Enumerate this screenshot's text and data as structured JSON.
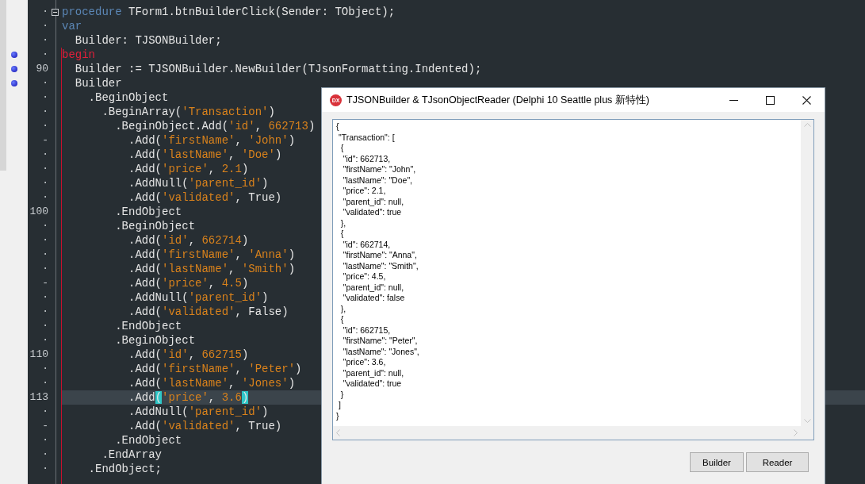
{
  "editor": {
    "lines": [
      {
        "gutter": "·",
        "breakpoint": false,
        "current": false,
        "foldable": true,
        "tokens": [
          {
            "kind": "keyword",
            "text": "procedure"
          },
          {
            "kind": "plain",
            "text": " TForm1.btnBuilderClick(Sender: TObject);"
          }
        ]
      },
      {
        "gutter": "·",
        "breakpoint": false,
        "current": false,
        "foldable": false,
        "tokens": [
          {
            "kind": "keyword",
            "text": "var"
          }
        ]
      },
      {
        "gutter": "·",
        "breakpoint": false,
        "current": false,
        "foldable": false,
        "tokens": [
          {
            "kind": "plain",
            "text": "  Builder: TJSONBuilder;"
          }
        ]
      },
      {
        "gutter": "·",
        "breakpoint": true,
        "current": false,
        "foldable": false,
        "tokens": [
          {
            "kind": "begin",
            "text": "begin"
          }
        ]
      },
      {
        "gutter": "90",
        "breakpoint": true,
        "current": false,
        "foldable": false,
        "tokens": [
          {
            "kind": "plain",
            "text": "  Builder := TJSONBuilder.NewBuilder(TJsonFormatting.Indented);"
          }
        ]
      },
      {
        "gutter": "·",
        "breakpoint": true,
        "current": false,
        "foldable": false,
        "tokens": [
          {
            "kind": "plain",
            "text": "  Builder"
          }
        ]
      },
      {
        "gutter": "·",
        "breakpoint": false,
        "current": false,
        "foldable": false,
        "tokens": [
          {
            "kind": "plain",
            "text": "    .BeginObject"
          }
        ]
      },
      {
        "gutter": "·",
        "breakpoint": false,
        "current": false,
        "foldable": false,
        "tokens": [
          {
            "kind": "plain",
            "text": "      .BeginArray("
          },
          {
            "kind": "string",
            "text": "'Transaction'"
          },
          {
            "kind": "plain",
            "text": ")"
          }
        ]
      },
      {
        "gutter": "·",
        "breakpoint": false,
        "current": false,
        "foldable": false,
        "tokens": [
          {
            "kind": "plain",
            "text": "        .BeginObject.Add("
          },
          {
            "kind": "string",
            "text": "'id'"
          },
          {
            "kind": "plain",
            "text": ", "
          },
          {
            "kind": "number",
            "text": "662713"
          },
          {
            "kind": "plain",
            "text": ")"
          }
        ]
      },
      {
        "gutter": "-",
        "breakpoint": false,
        "current": false,
        "foldable": false,
        "tokens": [
          {
            "kind": "plain",
            "text": "          .Add("
          },
          {
            "kind": "string",
            "text": "'firstName'"
          },
          {
            "kind": "plain",
            "text": ", "
          },
          {
            "kind": "string",
            "text": "'John'"
          },
          {
            "kind": "plain",
            "text": ")"
          }
        ]
      },
      {
        "gutter": "·",
        "breakpoint": false,
        "current": false,
        "foldable": false,
        "tokens": [
          {
            "kind": "plain",
            "text": "          .Add("
          },
          {
            "kind": "string",
            "text": "'lastName'"
          },
          {
            "kind": "plain",
            "text": ", "
          },
          {
            "kind": "string",
            "text": "'Doe'"
          },
          {
            "kind": "plain",
            "text": ")"
          }
        ]
      },
      {
        "gutter": "·",
        "breakpoint": false,
        "current": false,
        "foldable": false,
        "tokens": [
          {
            "kind": "plain",
            "text": "          .Add("
          },
          {
            "kind": "string",
            "text": "'price'"
          },
          {
            "kind": "plain",
            "text": ", "
          },
          {
            "kind": "number",
            "text": "2.1"
          },
          {
            "kind": "plain",
            "text": ")"
          }
        ]
      },
      {
        "gutter": "·",
        "breakpoint": false,
        "current": false,
        "foldable": false,
        "tokens": [
          {
            "kind": "plain",
            "text": "          .AddNull("
          },
          {
            "kind": "string",
            "text": "'parent_id'"
          },
          {
            "kind": "plain",
            "text": ")"
          }
        ]
      },
      {
        "gutter": "·",
        "breakpoint": false,
        "current": false,
        "foldable": false,
        "tokens": [
          {
            "kind": "plain",
            "text": "          .Add("
          },
          {
            "kind": "string",
            "text": "'validated'"
          },
          {
            "kind": "plain",
            "text": ", True)"
          }
        ]
      },
      {
        "gutter": "100",
        "breakpoint": false,
        "current": false,
        "foldable": false,
        "tokens": [
          {
            "kind": "plain",
            "text": "        .EndObject"
          }
        ]
      },
      {
        "gutter": "·",
        "breakpoint": false,
        "current": false,
        "foldable": false,
        "tokens": [
          {
            "kind": "plain",
            "text": "        .BeginObject"
          }
        ]
      },
      {
        "gutter": "·",
        "breakpoint": false,
        "current": false,
        "foldable": false,
        "tokens": [
          {
            "kind": "plain",
            "text": "          .Add("
          },
          {
            "kind": "string",
            "text": "'id'"
          },
          {
            "kind": "plain",
            "text": ", "
          },
          {
            "kind": "number",
            "text": "662714"
          },
          {
            "kind": "plain",
            "text": ")"
          }
        ]
      },
      {
        "gutter": "·",
        "breakpoint": false,
        "current": false,
        "foldable": false,
        "tokens": [
          {
            "kind": "plain",
            "text": "          .Add("
          },
          {
            "kind": "string",
            "text": "'firstName'"
          },
          {
            "kind": "plain",
            "text": ", "
          },
          {
            "kind": "string",
            "text": "'Anna'"
          },
          {
            "kind": "plain",
            "text": ")"
          }
        ]
      },
      {
        "gutter": "·",
        "breakpoint": false,
        "current": false,
        "foldable": false,
        "tokens": [
          {
            "kind": "plain",
            "text": "          .Add("
          },
          {
            "kind": "string",
            "text": "'lastName'"
          },
          {
            "kind": "plain",
            "text": ", "
          },
          {
            "kind": "string",
            "text": "'Smith'"
          },
          {
            "kind": "plain",
            "text": ")"
          }
        ]
      },
      {
        "gutter": "-",
        "breakpoint": false,
        "current": false,
        "foldable": false,
        "tokens": [
          {
            "kind": "plain",
            "text": "          .Add("
          },
          {
            "kind": "string",
            "text": "'price'"
          },
          {
            "kind": "plain",
            "text": ", "
          },
          {
            "kind": "number",
            "text": "4.5"
          },
          {
            "kind": "plain",
            "text": ")"
          }
        ]
      },
      {
        "gutter": "·",
        "breakpoint": false,
        "current": false,
        "foldable": false,
        "tokens": [
          {
            "kind": "plain",
            "text": "          .AddNull("
          },
          {
            "kind": "string",
            "text": "'parent_id'"
          },
          {
            "kind": "plain",
            "text": ")"
          }
        ]
      },
      {
        "gutter": "·",
        "breakpoint": false,
        "current": false,
        "foldable": false,
        "tokens": [
          {
            "kind": "plain",
            "text": "          .Add("
          },
          {
            "kind": "string",
            "text": "'validated'"
          },
          {
            "kind": "plain",
            "text": ", False)"
          }
        ]
      },
      {
        "gutter": "·",
        "breakpoint": false,
        "current": false,
        "foldable": false,
        "tokens": [
          {
            "kind": "plain",
            "text": "        .EndObject"
          }
        ]
      },
      {
        "gutter": "·",
        "breakpoint": false,
        "current": false,
        "foldable": false,
        "tokens": [
          {
            "kind": "plain",
            "text": "        .BeginObject"
          }
        ]
      },
      {
        "gutter": "110",
        "breakpoint": false,
        "current": false,
        "foldable": false,
        "tokens": [
          {
            "kind": "plain",
            "text": "          .Add("
          },
          {
            "kind": "string",
            "text": "'id'"
          },
          {
            "kind": "plain",
            "text": ", "
          },
          {
            "kind": "number",
            "text": "662715"
          },
          {
            "kind": "plain",
            "text": ")"
          }
        ]
      },
      {
        "gutter": "·",
        "breakpoint": false,
        "current": false,
        "foldable": false,
        "tokens": [
          {
            "kind": "plain",
            "text": "          .Add("
          },
          {
            "kind": "string",
            "text": "'firstName'"
          },
          {
            "kind": "plain",
            "text": ", "
          },
          {
            "kind": "string",
            "text": "'Peter'"
          },
          {
            "kind": "plain",
            "text": ")"
          }
        ]
      },
      {
        "gutter": "·",
        "breakpoint": false,
        "current": false,
        "foldable": false,
        "tokens": [
          {
            "kind": "plain",
            "text": "          .Add("
          },
          {
            "kind": "string",
            "text": "'lastName'"
          },
          {
            "kind": "plain",
            "text": ", "
          },
          {
            "kind": "string",
            "text": "'Jones'"
          },
          {
            "kind": "plain",
            "text": ")"
          }
        ]
      },
      {
        "gutter": "113",
        "breakpoint": false,
        "current": true,
        "foldable": false,
        "tokens": [
          {
            "kind": "plain",
            "text": "          .Add"
          },
          {
            "kind": "match",
            "text": "("
          },
          {
            "kind": "string",
            "text": "'price'"
          },
          {
            "kind": "plain",
            "text": ", "
          },
          {
            "kind": "number",
            "text": "3.6"
          },
          {
            "kind": "match",
            "text": ")"
          }
        ]
      },
      {
        "gutter": "·",
        "breakpoint": false,
        "current": false,
        "foldable": false,
        "tokens": [
          {
            "kind": "plain",
            "text": "          .AddNull("
          },
          {
            "kind": "string",
            "text": "'parent_id'"
          },
          {
            "kind": "plain",
            "text": ")"
          }
        ]
      },
      {
        "gutter": "-",
        "breakpoint": false,
        "current": false,
        "foldable": false,
        "tokens": [
          {
            "kind": "plain",
            "text": "          .Add("
          },
          {
            "kind": "string",
            "text": "'validated'"
          },
          {
            "kind": "plain",
            "text": ", True)"
          }
        ]
      },
      {
        "gutter": "·",
        "breakpoint": false,
        "current": false,
        "foldable": false,
        "tokens": [
          {
            "kind": "plain",
            "text": "        .EndObject"
          }
        ]
      },
      {
        "gutter": "·",
        "breakpoint": false,
        "current": false,
        "foldable": false,
        "tokens": [
          {
            "kind": "plain",
            "text": "      .EndArray"
          }
        ]
      },
      {
        "gutter": "·",
        "breakpoint": false,
        "current": false,
        "foldable": false,
        "tokens": [
          {
            "kind": "plain",
            "text": "    .EndObject;"
          }
        ]
      }
    ]
  },
  "dialog": {
    "logo_text": "DX",
    "title": "TJSONBuilder & TJsonObjectReader (Delphi 10 Seattle plus 新特性)",
    "memo_lines": [
      "{",
      " \"Transaction\": [",
      "  {",
      "   \"id\": 662713,",
      "   \"firstName\": \"John\",",
      "   \"lastName\": \"Doe\",",
      "   \"price\": 2.1,",
      "   \"parent_id\": null,",
      "   \"validated\": true",
      "  },",
      "  {",
      "   \"id\": 662714,",
      "   \"firstName\": \"Anna\",",
      "   \"lastName\": \"Smith\",",
      "   \"price\": 4.5,",
      "   \"parent_id\": null,",
      "   \"validated\": false",
      "  },",
      "  {",
      "   \"id\": 662715,",
      "   \"firstName\": \"Peter\",",
      "   \"lastName\": \"Jones\",",
      "   \"price\": 3.6,",
      "   \"parent_id\": null,",
      "   \"validated\": true",
      "  }",
      " ]",
      "}"
    ],
    "buttons": [
      "Builder",
      "Reader"
    ]
  }
}
